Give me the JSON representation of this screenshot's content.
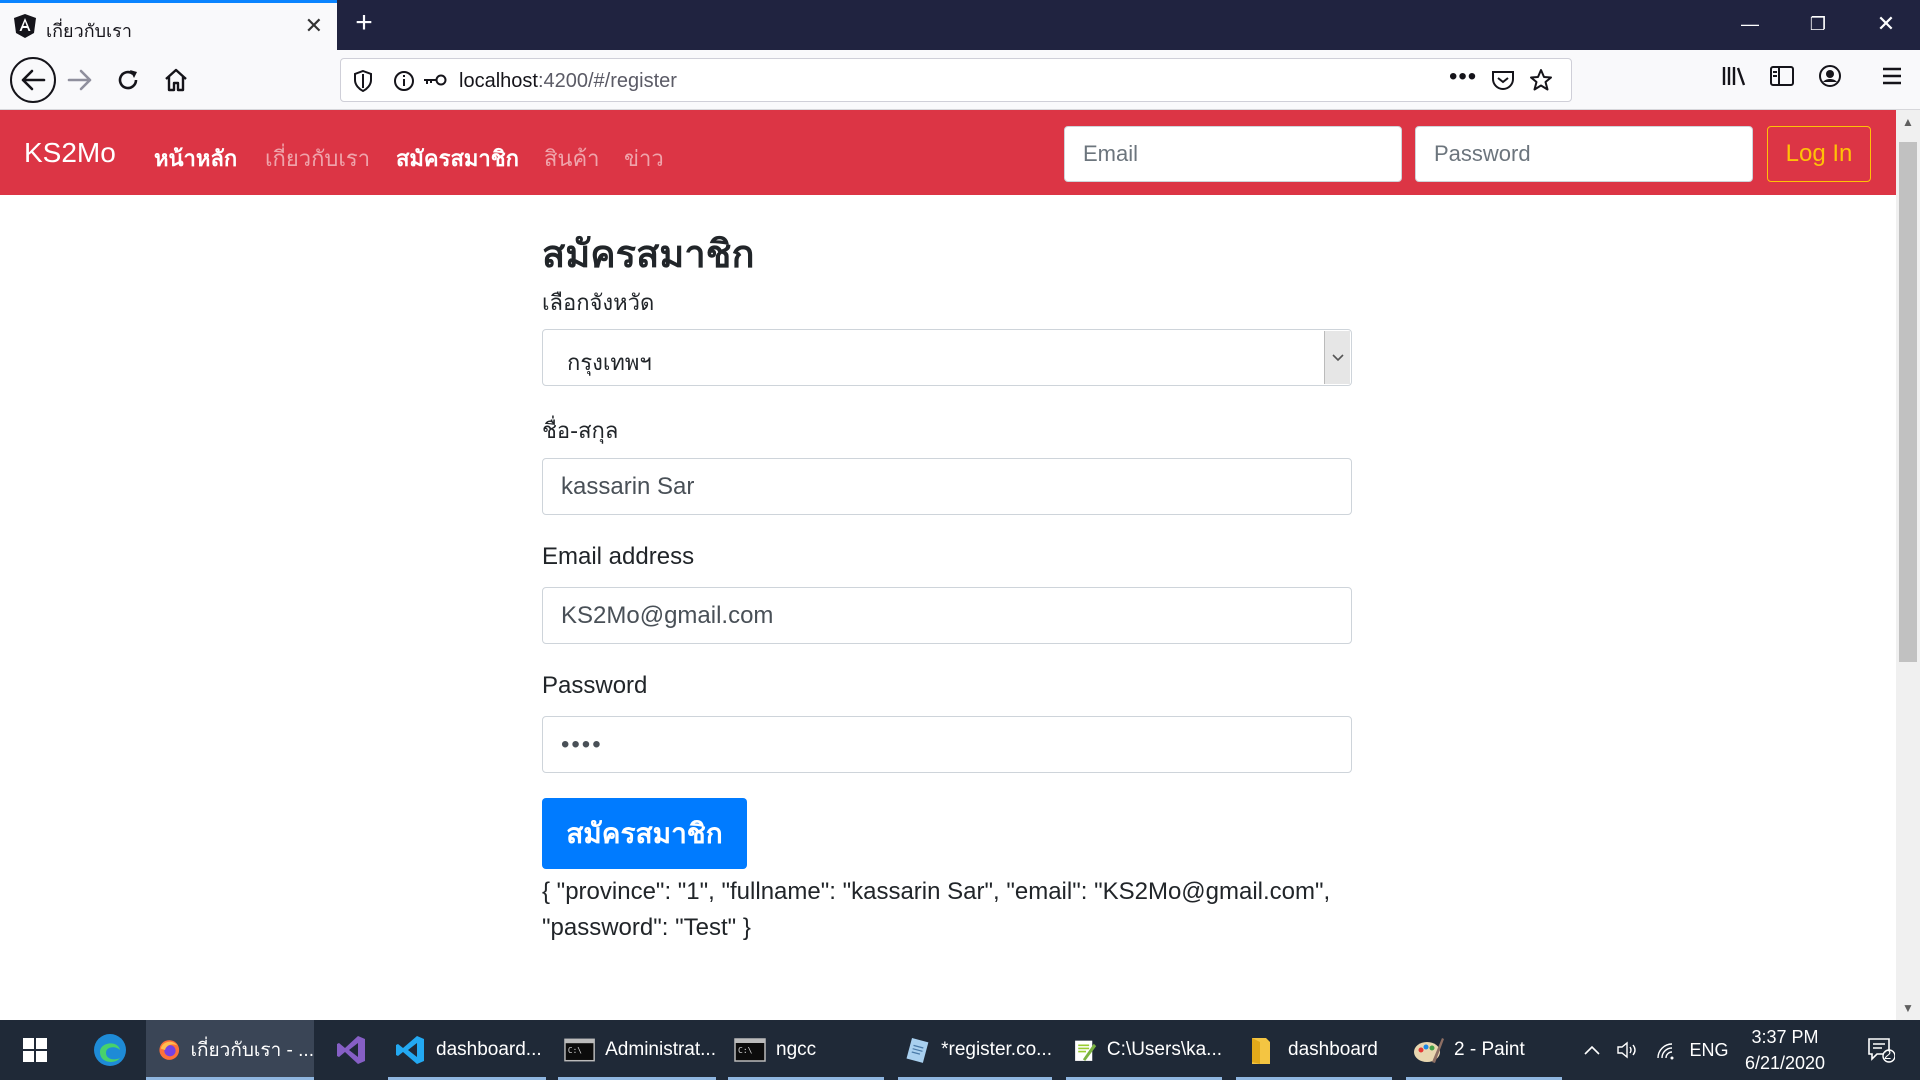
{
  "browser": {
    "tab_title": "เกี่ยวกับเรา",
    "url_host": "localhost",
    "url_rest": ":4200/#/register"
  },
  "app": {
    "brand": "KS2Mo",
    "nav": [
      "หน้าหลัก",
      "เกี่ยวกับเรา",
      "สมัครสมาชิก",
      "สินค้า",
      "ข่าว"
    ],
    "email_placeholder": "Email",
    "password_placeholder": "Password",
    "login_label": "Log In"
  },
  "form": {
    "title": "สมัครสมาชิก",
    "province_label": "เลือกจังหวัด",
    "province_value": "กรุงเทพฯ",
    "fullname_label": "ชื่อ-สกุล",
    "fullname_value": "kassarin Sar",
    "email_label": "Email address",
    "email_value": "KS2Mo@gmail.com",
    "password_label": "Password",
    "password_value": "Test",
    "submit_label": "สมัครสมาชิก",
    "json_output": "{ \"province\": \"1\", \"fullname\": \"kassarin Sar\", \"email\": \"KS2Mo@gmail.com\", \"password\": \"Test\" }"
  },
  "taskbar": {
    "items": [
      {
        "label": "เกี่ยวกับเรา - ...",
        "icon": "firefox-icon"
      },
      {
        "label": "",
        "icon": "visual-studio-icon"
      },
      {
        "label": "dashboard...",
        "icon": "vscode-icon"
      },
      {
        "label": "Administrat...",
        "icon": "terminal-icon"
      },
      {
        "label": "ngcc",
        "icon": "terminal-icon"
      },
      {
        "label": "*register.co...",
        "icon": "notepad-icon"
      },
      {
        "label": "C:\\Users\\ka...",
        "icon": "notepadpp-icon"
      },
      {
        "label": "dashboard",
        "icon": "folder-icon"
      },
      {
        "label": "2 - Paint",
        "icon": "paint-icon"
      }
    ],
    "language": "ENG",
    "time": "3:37 PM",
    "date": "6/21/2020",
    "notification_count": "2"
  },
  "colors": {
    "navbar": "#dc3545",
    "primary": "#007bff",
    "warning": "#ffc107",
    "tabbar": "#202340",
    "taskbar": "#1f2937"
  }
}
